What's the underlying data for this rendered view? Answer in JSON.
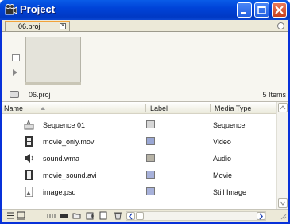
{
  "window": {
    "title": "Project"
  },
  "tab": {
    "label": "06.proj",
    "close_glyph": "×"
  },
  "info": {
    "project_name": "06.proj",
    "item_count": "5 Items"
  },
  "columns": {
    "name": "Name",
    "label": "Label",
    "media_type": "Media Type"
  },
  "rows": [
    {
      "name": "Sequence 01",
      "media_type": "Sequence",
      "icon": "sequence-icon",
      "label_color": "#d6d6d6"
    },
    {
      "name": "movie_only.mov",
      "media_type": "Video",
      "icon": "film-icon",
      "label_color": "#9aa7d4"
    },
    {
      "name": "sound.wma",
      "media_type": "Audio",
      "icon": "speaker-icon",
      "label_color": "#b7b3a6"
    },
    {
      "name": "movie_sound.avi",
      "media_type": "Movie",
      "icon": "film-icon",
      "label_color": "#a7b1da"
    },
    {
      "name": "image.psd",
      "media_type": "Still Image",
      "icon": "image-file-icon",
      "label_color": "#a7b1da"
    }
  ],
  "colors": {
    "title_bar": "#0043d8",
    "panel": "#ece9d8",
    "tab_accent": "#f2a33a",
    "close_button": "#c8401d"
  }
}
